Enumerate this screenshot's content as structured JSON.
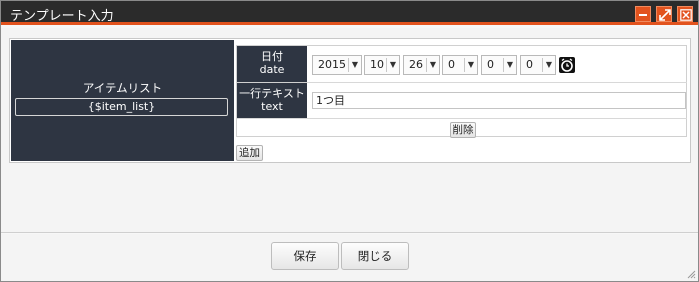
{
  "window": {
    "title": "テンプレート入力"
  },
  "left": {
    "label": "アイテムリスト",
    "variable": "{$item_list}"
  },
  "row_date": {
    "label_jp": "日付",
    "label_en": "date",
    "year": "2015",
    "month": "10",
    "day": "26",
    "hour": "0",
    "minute": "0",
    "second": "0"
  },
  "row_text": {
    "label_jp": "一行テキスト",
    "label_en": "text",
    "value": "1つ目"
  },
  "buttons": {
    "delete": "削除",
    "add": "追加",
    "save": "保存",
    "close": "閉じる"
  },
  "icons": {
    "minimize": "minimize-icon",
    "maximize": "maximize-icon",
    "close": "close-icon",
    "clock": "clock-icon",
    "resize": "resize-grip-icon"
  },
  "colors": {
    "titlebar": "#2b2b2b",
    "accent": "#e2531e",
    "header_cell": "#2e3542"
  }
}
